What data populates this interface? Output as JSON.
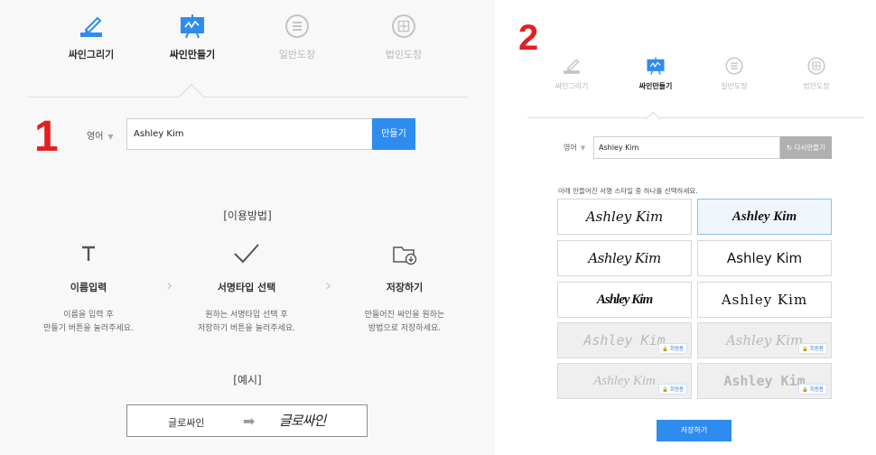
{
  "panel1": {
    "number": "1",
    "tabs": [
      {
        "label": "싸인그리기",
        "icon": "pen-draw-icon",
        "state": "normal"
      },
      {
        "label": "싸인만들기",
        "icon": "signature-board-icon",
        "state": "active"
      },
      {
        "label": "일반도장",
        "icon": "stamp-lines-icon",
        "state": "dim"
      },
      {
        "label": "법인도장",
        "icon": "corporate-seal-icon",
        "state": "dim"
      }
    ],
    "language": "영어",
    "name_value": "Ashley Kim",
    "create_button": "만들기",
    "howto_title": "[이용방법]",
    "steps": [
      {
        "icon": "text-t-icon",
        "title": "이름입력",
        "desc1": "이름을 입력 후",
        "desc2": "만들기 버튼을 눌러주세요."
      },
      {
        "icon": "checkmark-icon",
        "title": "서명타입 선택",
        "desc1": "원하는 서명타입 선택 후",
        "desc2": "저장하기 버튼을 눌러주세요."
      },
      {
        "icon": "download-file-icon",
        "title": "저장하기",
        "desc1": "만들어진 싸인을 원하는",
        "desc2": "방법으로 저장하세요."
      }
    ],
    "example_title": "[예시]",
    "example_plain": "글로싸인",
    "example_arrow": "➡",
    "example_styled": "글로싸인"
  },
  "panel2": {
    "number": "2",
    "tabs": [
      {
        "label": "싸인그리기",
        "icon": "pen-draw-icon",
        "state": "dim"
      },
      {
        "label": "싸인만들기",
        "icon": "signature-board-icon",
        "state": "active"
      },
      {
        "label": "일반도장",
        "icon": "stamp-lines-icon",
        "state": "dim"
      },
      {
        "label": "법인도장",
        "icon": "corporate-seal-icon",
        "state": "dim"
      }
    ],
    "language": "영어",
    "name_value": "Ashley Kim",
    "remake_button": "↻ 다시만들기",
    "instruction": "아래 만들어진 서명 스타일 중 하나를 선택하세요.",
    "signatures": [
      {
        "text": "Ashley Kim",
        "state": "normal",
        "badge": ""
      },
      {
        "text": "Ashley Kim",
        "state": "selected",
        "badge": ""
      },
      {
        "text": "Ashley Kim",
        "state": "normal",
        "badge": ""
      },
      {
        "text": "Ashley Kim",
        "state": "normal",
        "badge": ""
      },
      {
        "text": "Ashley Kim",
        "state": "normal",
        "badge": ""
      },
      {
        "text": "Ashley Kim",
        "state": "normal",
        "badge": ""
      },
      {
        "text": "Ashley Kim",
        "state": "locked",
        "badge": "🔒 회원용"
      },
      {
        "text": "Ashley Kim",
        "state": "locked",
        "badge": "🔒 회원용"
      },
      {
        "text": "Ashley Kim",
        "state": "locked",
        "badge": "🔒 회원용"
      },
      {
        "text": "Ashley Kim",
        "state": "locked",
        "badge": "🔒 회원용"
      }
    ],
    "save_button": "저장하기"
  },
  "colors": {
    "accent": "#2f8cef",
    "number_red": "#e32020",
    "remake_gray": "#b0b0b0",
    "selected_border": "#8fbfe8"
  }
}
